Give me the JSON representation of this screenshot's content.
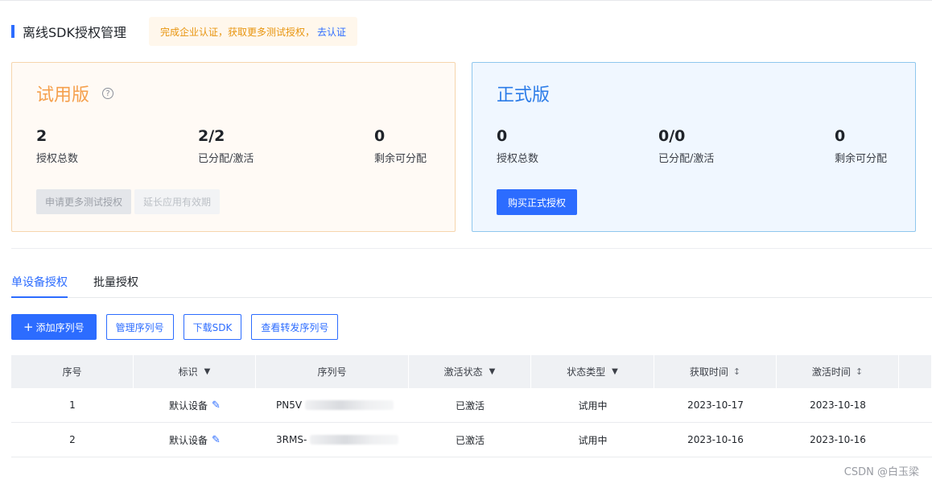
{
  "header": {
    "title": "离线SDK授权管理",
    "notice_text": "完成企业认证，获取更多测试授权，",
    "notice_link": "去认证"
  },
  "trial_card": {
    "title": "试用版",
    "help_icon": "question-circle-icon",
    "stats": [
      {
        "value": "2",
        "label": "授权总数"
      },
      {
        "value": "2/2",
        "label": "已分配/激活"
      },
      {
        "value": "0",
        "label": "剩余可分配"
      }
    ],
    "apply_button": "申请更多测试授权",
    "extend_button": "延长应用有效期"
  },
  "formal_card": {
    "title": "正式版",
    "stats": [
      {
        "value": "0",
        "label": "授权总数"
      },
      {
        "value": "0/0",
        "label": "已分配/激活"
      },
      {
        "value": "0",
        "label": "剩余可分配"
      }
    ],
    "buy_button": "购买正式授权"
  },
  "tabs": [
    {
      "label": "单设备授权",
      "active": true
    },
    {
      "label": "批量授权",
      "active": false
    }
  ],
  "actions": {
    "add_serial": "添加序列号",
    "manage_serial": "管理序列号",
    "download_sdk": "下载SDK",
    "view_forwarded": "查看转发序列号"
  },
  "table": {
    "columns": [
      "序号",
      "标识",
      "序列号",
      "激活状态",
      "状态类型",
      "获取时间",
      "激活时间"
    ],
    "rows": [
      {
        "index": "1",
        "tag": "默认设备",
        "serial": "PN5V",
        "activation": "已激活",
        "status_type": "试用中",
        "obtained": "2023-10-17",
        "activated": "2023-10-18"
      },
      {
        "index": "2",
        "tag": "默认设备",
        "serial": "3RMS-",
        "activation": "已激活",
        "status_type": "试用中",
        "obtained": "2023-10-16",
        "activated": "2023-10-16"
      }
    ]
  },
  "watermark": "CSDN @白玉梁",
  "colors": {
    "accent": "#2c6cff",
    "trial_title": "#f5a04d",
    "formal_title": "#2c7ce8",
    "notice_text": "#e8950f"
  }
}
